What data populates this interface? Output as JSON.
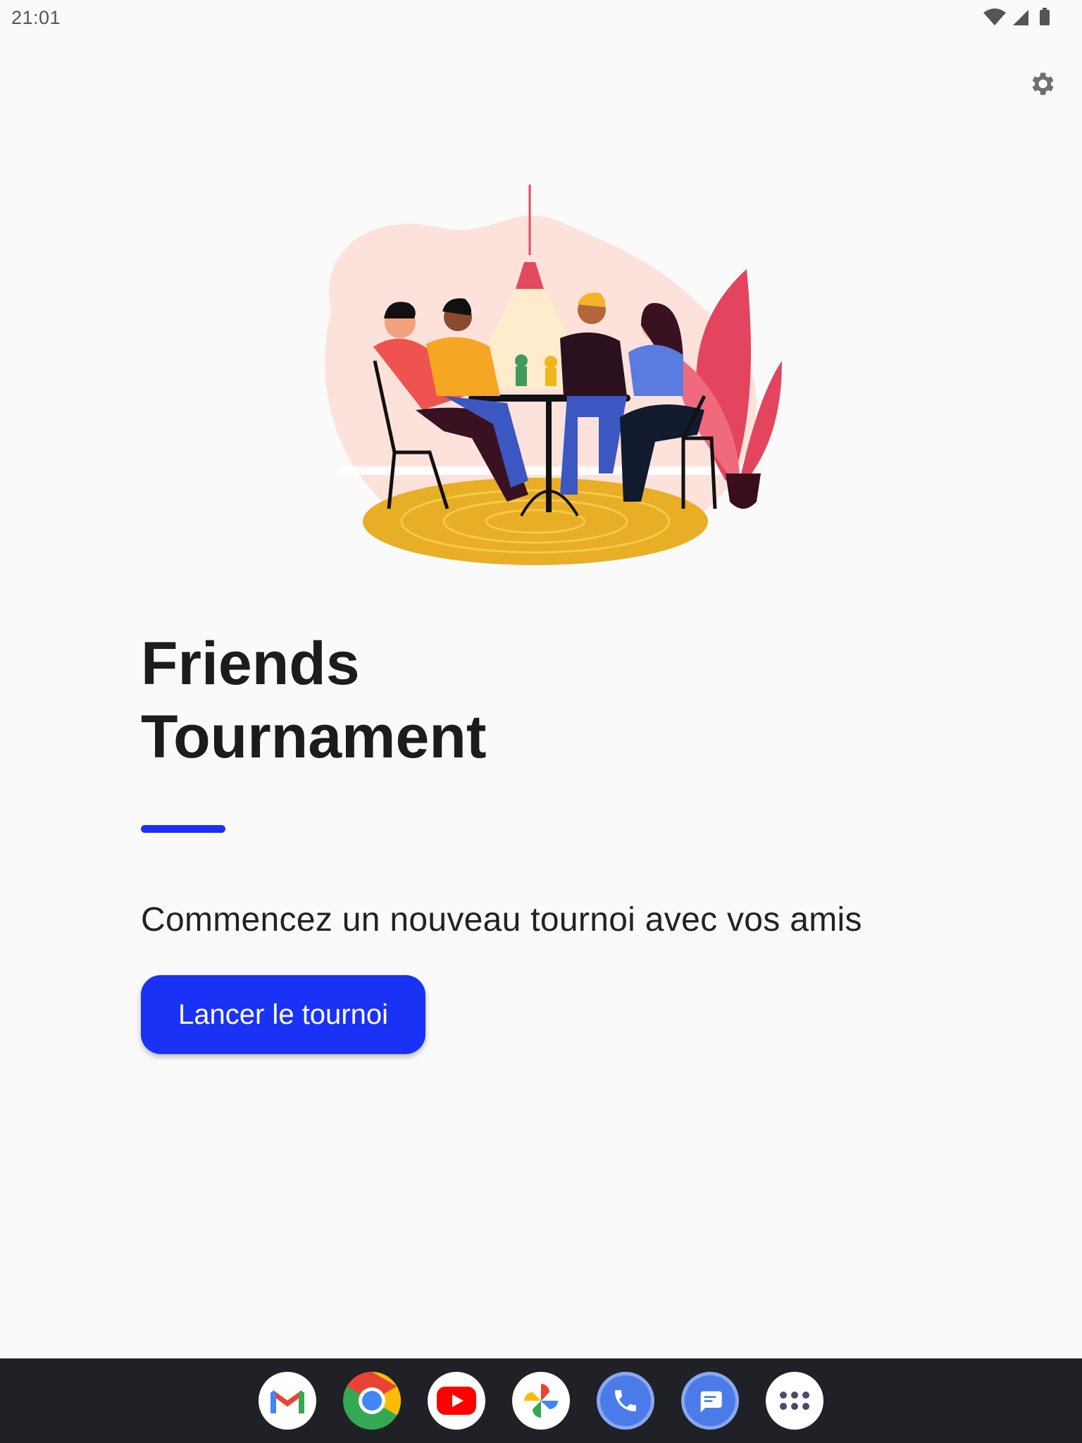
{
  "status_bar": {
    "time": "21:01",
    "icons": [
      "wifi-icon",
      "signal-icon",
      "battery-icon"
    ]
  },
  "toolbar": {
    "settings_icon": "gear-icon"
  },
  "hero": {
    "illustration": "friends-playing-board-game-illustration",
    "title_line1": "Friends",
    "title_line2": "Tournament",
    "subtitle": "Commencez un nouveau tournoi avec vos amis",
    "launch_label": "Lancer le tournoi"
  },
  "colors": {
    "accent": "#1a32f5",
    "background": "#fafafa",
    "dock": "#202126"
  },
  "dock": {
    "apps": [
      "gmail-icon",
      "chrome-icon",
      "youtube-icon",
      "photos-icon",
      "phone-icon",
      "messages-icon",
      "app-drawer-icon"
    ]
  }
}
